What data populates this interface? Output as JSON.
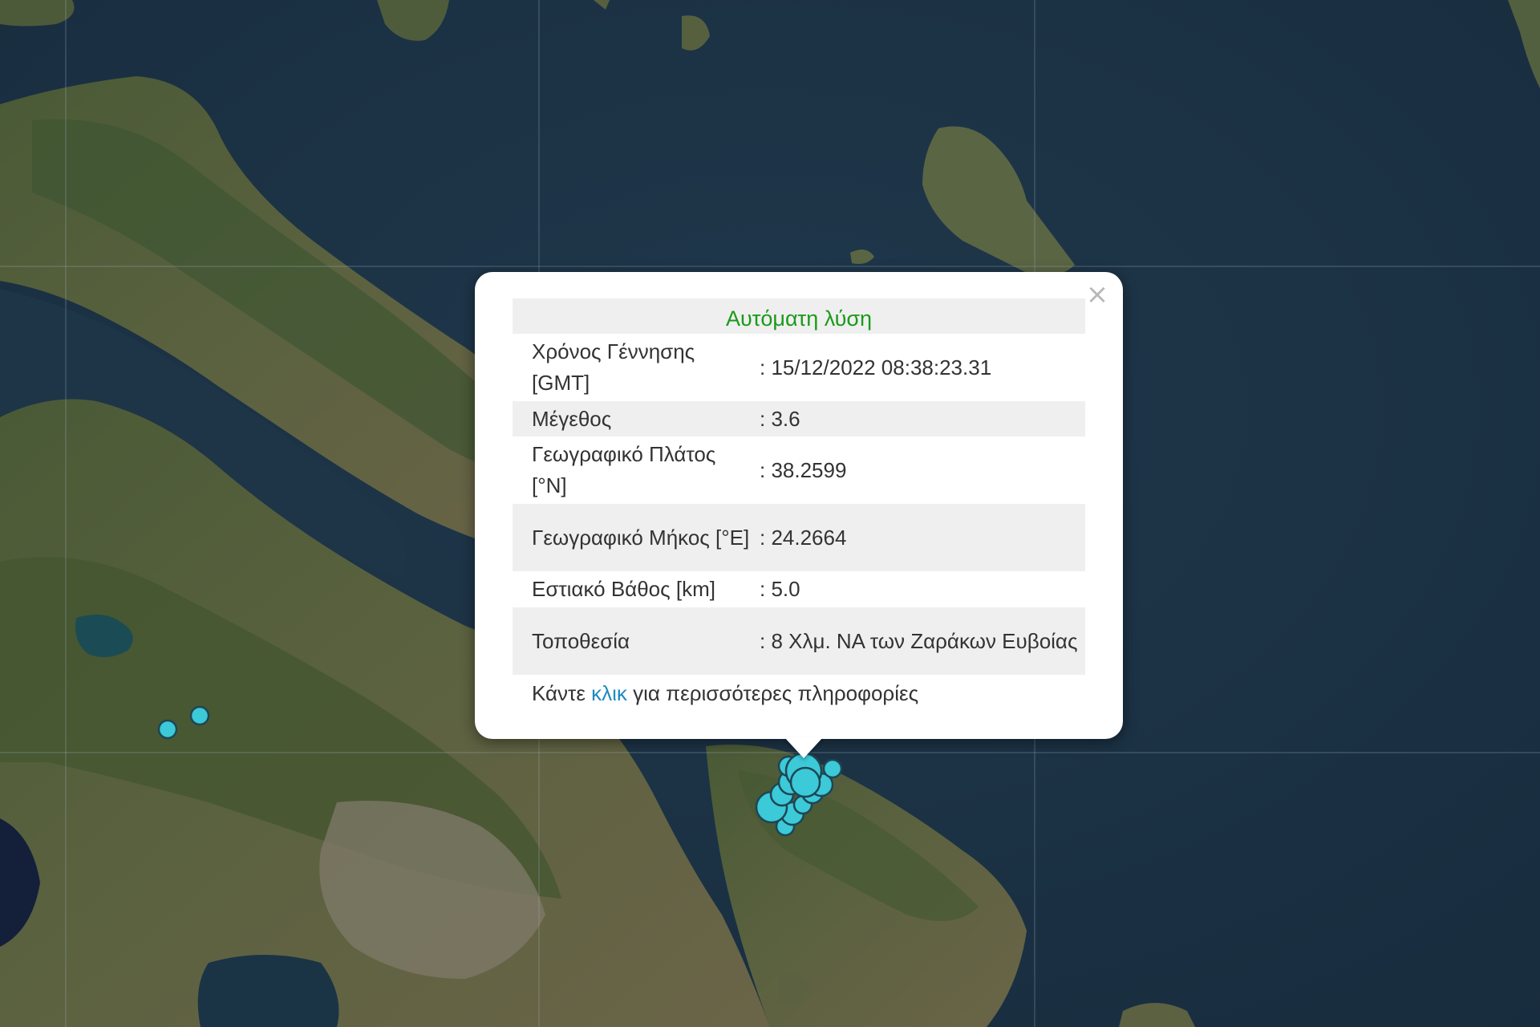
{
  "popup": {
    "close_symbol": "×",
    "title": "Αυτόματη λύση",
    "title_color": "#1a9a1a",
    "rows": [
      {
        "label": "Χρόνος Γέννησης [GMT]",
        "value": ": 15/12/2022 08:38:23.31"
      },
      {
        "label": "Μέγεθος",
        "value": ": 3.6"
      },
      {
        "label": "Γεωγραφικό Πλάτος [°N]",
        "value": ": 38.2599"
      },
      {
        "label": "Γεωγραφικό Μήκος [°E]",
        "value": ": 24.2664"
      },
      {
        "label": "Εστιακό Βάθος [km]",
        "value": ": 5.0"
      },
      {
        "label": "Τοποθεσία",
        "value": ": 8 Χλμ. ΝΑ των Ζαράκων Ευβοίας"
      }
    ],
    "footer_before": "Κάντε ",
    "footer_link": "κλικ",
    "footer_after": " για περισσότερες πληροφορίες",
    "link_color": "#1f8bc2"
  },
  "map": {
    "imagery": "satellite",
    "sea_color": "#1c3346",
    "marker_color": "#3cc9d8",
    "marker_outline": "#1d4654"
  }
}
